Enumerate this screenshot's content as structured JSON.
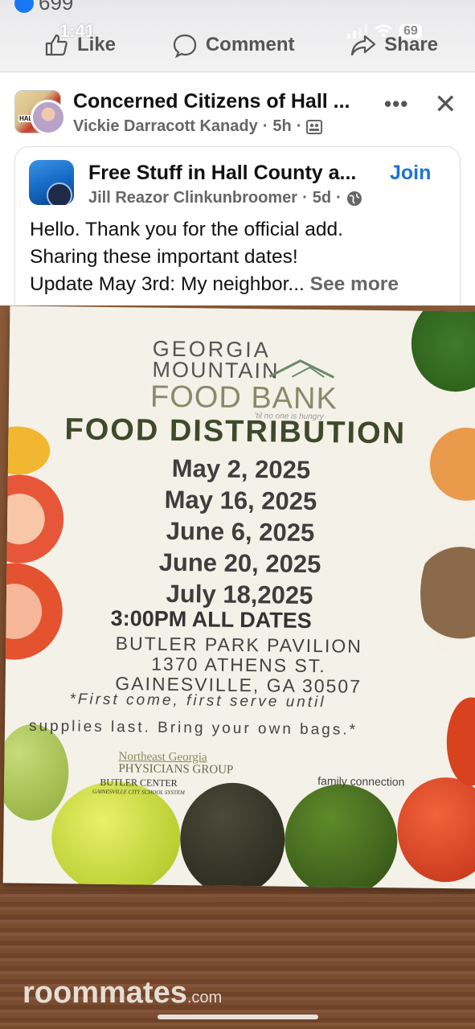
{
  "status": {
    "time": "1:41",
    "battery": "69",
    "like_count": "699"
  },
  "action_bar": {
    "like": "Like",
    "comment": "Comment",
    "share": "Share"
  },
  "post": {
    "group_name": "Concerned Citizens of Hall ...",
    "author": "Vickie Darracott Kanady",
    "time": "5h",
    "more_icon": "more-dots-icon",
    "close_icon": "close-icon"
  },
  "shared_post": {
    "group_name": "Free Stuff in Hall County a...",
    "join": "Join",
    "author": "Jill Reazor Clinkunbroomer",
    "time": "5d",
    "line1": "Hello. Thank you for the official add.",
    "line2": "Sharing these important dates!",
    "line3": "Update May 3rd: My neighbor...",
    "see_more": "See more"
  },
  "flyer": {
    "org_line1": "GEORGIA",
    "org_line2": "MOUNTAIN",
    "org_line3": "FOOD BANK",
    "tagline": "'til no one is hungry",
    "title": "FOOD DISTRIBUTION",
    "dates": [
      "May 2, 2025",
      "May 16, 2025",
      "June 6, 2025",
      "June 20, 2025",
      "July 18,2025"
    ],
    "time": "3:00PM ALL DATES",
    "address_line1": "BUTLER PARK PAVILION",
    "address_line2": "1370 ATHENS ST.",
    "address_line3": "GAINESVILLE, GA 30507",
    "note_line1": "*First come, first serve until",
    "note_line2": "supplies last. Bring your own bags.*",
    "sponsor_a_line1": "Northeast Georgia",
    "sponsor_a_line2": "PHYSICIANS GROUP",
    "sponsor_b_line1": "BUTLER CENTER",
    "sponsor_b_line2": "GAINESVILLE CITY SCHOOL SYSTEM",
    "sponsor_c": "family connection"
  },
  "watermark": {
    "name": "roommates",
    "suffix": ".com"
  },
  "colors": {
    "link_blue": "#1a73d8",
    "flyer_title": "#3e4a2a"
  }
}
